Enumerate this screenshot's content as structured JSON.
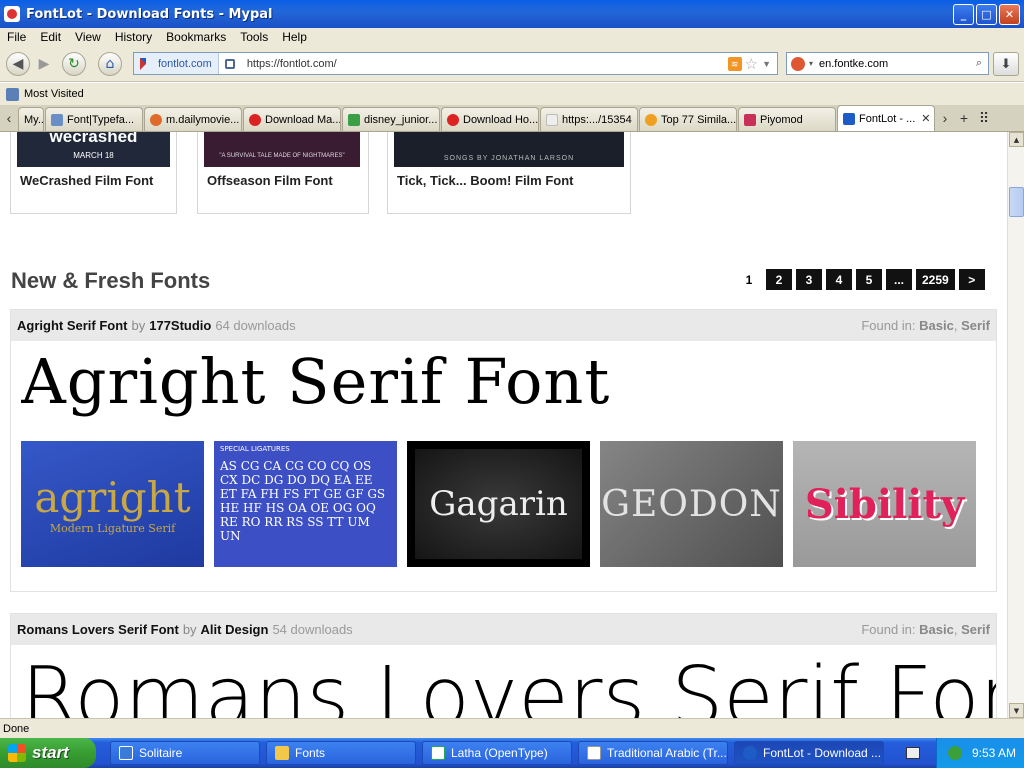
{
  "window": {
    "title": "FontLot - Download Fonts - Mypal",
    "minimize": "_",
    "maximize": "□",
    "close": "✕"
  },
  "menu": [
    "File",
    "Edit",
    "View",
    "History",
    "Bookmarks",
    "Tools",
    "Help"
  ],
  "nav": {
    "back": "◀",
    "forward": "▶",
    "reload": "↻",
    "home": "⌂",
    "identity": "fontlot.com",
    "url": "https://fontlot.com/",
    "search_value": "en.fontke.com",
    "download": "⬇"
  },
  "bookmarks": {
    "most_visited": "Most Visited"
  },
  "tabs": [
    {
      "label": "My...",
      "color": "#cfcfcf"
    },
    {
      "label": "Font|Typefa...",
      "color": "#6a8fc7"
    },
    {
      "label": "m.dailymovie...",
      "color": "#e06a2a"
    },
    {
      "label": "Download Ma...",
      "color": "#d22"
    },
    {
      "label": "disney_junior...",
      "color": "#3a9f45"
    },
    {
      "label": "Download Ho...",
      "color": "#d22"
    },
    {
      "label": "https:.../15354",
      "color": "#eee"
    },
    {
      "label": "Top 77 Simila...",
      "color": "#f0a020"
    },
    {
      "label": "Piyomod",
      "color": "#c8305a"
    },
    {
      "label": "FontLot - ...",
      "color": "#1d5bc5",
      "active": true
    }
  ],
  "top_cards": [
    {
      "title": "WeCrashed Film Font",
      "img_text": "wecrashed",
      "img_sub": "MARCH 18"
    },
    {
      "title": "Offseason Film Font",
      "img_text": "",
      "img_sub": "\"A SURVIVAL TALE MADE OF NIGHTMARES\""
    },
    {
      "title": "Tick, Tick... Boom! Film Font",
      "img_text": "",
      "img_sub": "SONGS BY JONATHAN LARSON"
    }
  ],
  "section_title": "New & Fresh Fonts",
  "pagination": [
    "1",
    "2",
    "3",
    "4",
    "5",
    "...",
    "2259",
    ">"
  ],
  "fonts": [
    {
      "name": "Agright Serif Font",
      "by": "by",
      "author": "177Studio",
      "downloads": "64 downloads",
      "found_label": "Found in:",
      "cat1": "Basic",
      "sep": ",",
      "cat2": "Serif",
      "preview": "Agright Serif Font",
      "thumbs": [
        {
          "text": "agright",
          "sub": "Modern Ligature Serif",
          "bg": "#2a4bb8",
          "fg": "#c8a846"
        },
        {
          "text": "AS CG CA CG CO CQ OS CX DC DG DO DQ EA EE ET FA FH FS FT GE GF GS HE HF HS OA OE OG OQ RE RO RR RS SS TT UM UN",
          "sub": "SPECIAL LIGATURES",
          "bg": "#3d4fc4",
          "fg": "#ffffff"
        },
        {
          "text": "Gagarin",
          "sub": "",
          "bg": "#2a2a2a",
          "fg": "#f0f0f0"
        },
        {
          "text": "GEODON",
          "sub": "",
          "bg": "#6d6d6d",
          "fg": "#d8d8d8"
        },
        {
          "text": "Sibility",
          "sub": "",
          "bg": "#a9a9a9",
          "fg": "#e0215a"
        }
      ]
    },
    {
      "name": "Romans Lovers Serif Font",
      "by": "by",
      "author": "Alit Design",
      "downloads": "54 downloads",
      "found_label": "Found in:",
      "cat1": "Basic",
      "sep": ",",
      "cat2": "Serif",
      "preview": "Romans Lovers Serif Font"
    }
  ],
  "status": "Done",
  "taskbar": {
    "start": "start",
    "tasks": [
      "Solitaire",
      "Fonts",
      "Latha (OpenType)",
      "Traditional Arabic (Tr...",
      "FontLot - Download ..."
    ],
    "time": "9:53 AM"
  }
}
